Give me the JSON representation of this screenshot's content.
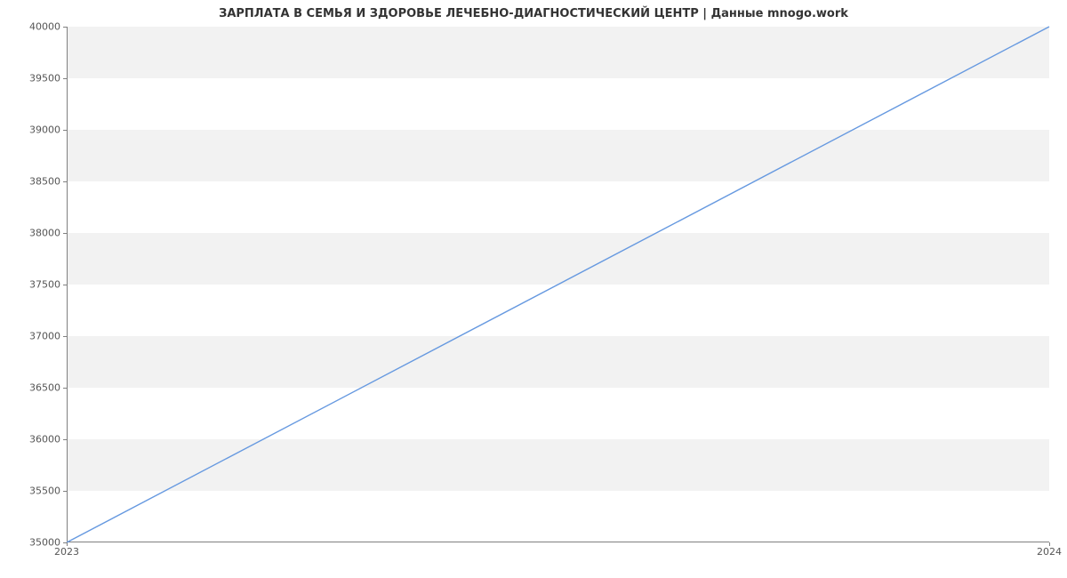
{
  "chart_data": {
    "type": "line",
    "title": "ЗАРПЛАТА В СЕМЬЯ И ЗДОРОВЬЕ ЛЕЧЕБНО-ДИАГНОСТИЧЕСКИЙ ЦЕНТР  | Данные mnogo.work",
    "xlabel": "",
    "ylabel": "",
    "x": [
      2023,
      2024
    ],
    "series": [
      {
        "name": "salary",
        "values": [
          35000,
          40000
        ],
        "color": "#6699e0"
      }
    ],
    "xlim": [
      2023,
      2024
    ],
    "ylim": [
      35000,
      40000
    ],
    "x_ticks": [
      2023,
      2024
    ],
    "y_ticks": [
      35000,
      35500,
      36000,
      36500,
      37000,
      37500,
      38000,
      38500,
      39000,
      39500,
      40000
    ]
  }
}
